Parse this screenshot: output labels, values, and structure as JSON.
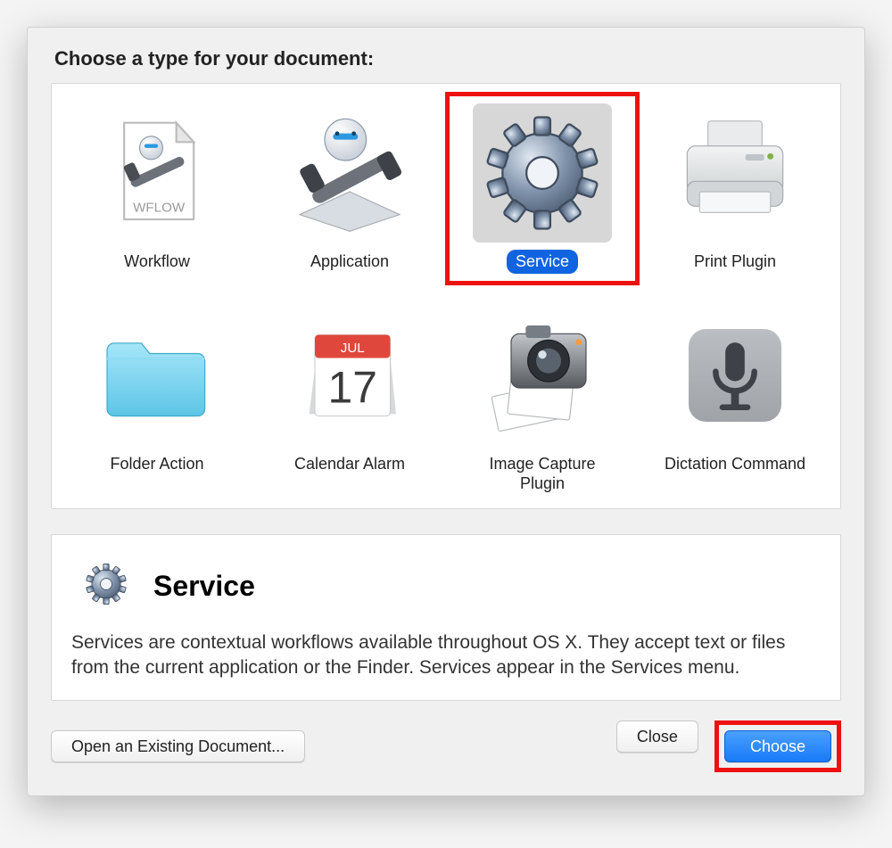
{
  "dialog": {
    "heading": "Choose a type for your document:",
    "types": [
      {
        "id": "workflow",
        "label": "Workflow"
      },
      {
        "id": "application",
        "label": "Application"
      },
      {
        "id": "service",
        "label": "Service",
        "selected": true
      },
      {
        "id": "print-plugin",
        "label": "Print Plugin"
      },
      {
        "id": "folder-action",
        "label": "Folder Action"
      },
      {
        "id": "calendar-alarm",
        "label": "Calendar Alarm",
        "calendar_month": "JUL",
        "calendar_day": "17"
      },
      {
        "id": "image-capture-plugin",
        "label": "Image Capture Plugin"
      },
      {
        "id": "dictation-command",
        "label": "Dictation Command"
      }
    ],
    "description": {
      "title": "Service",
      "text": "Services are contextual workflows available throughout OS X. They accept text or files from the current application or the Finder. Services appear in the Services menu."
    },
    "buttons": {
      "open_existing": "Open an Existing Document...",
      "close": "Close",
      "choose": "Choose"
    },
    "annotation": {
      "highlighted_type": "service",
      "highlighted_button": "choose"
    }
  },
  "workflow_tag": "WFLOW"
}
